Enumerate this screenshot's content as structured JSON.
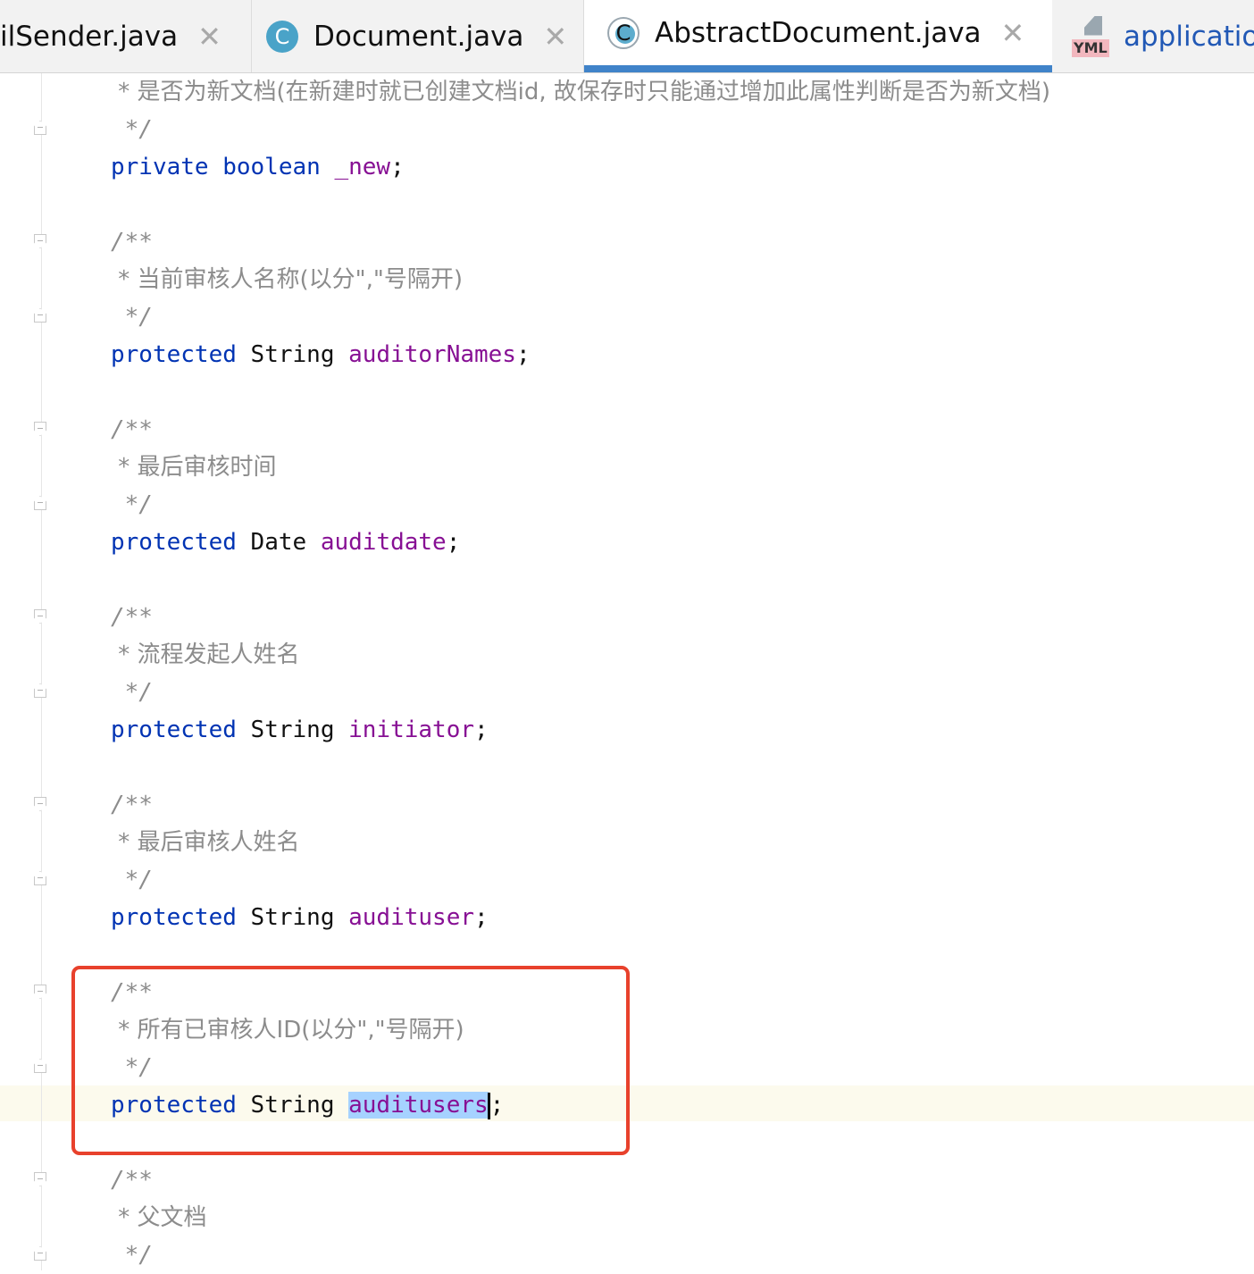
{
  "tabs": [
    {
      "label": "ilSender.java",
      "icon": "none",
      "closable": true
    },
    {
      "label": "Document.java",
      "icon": "class-icon",
      "closable": true
    },
    {
      "label": "AbstractDocument.java",
      "icon": "abstract-class-icon",
      "closable": true,
      "active": true
    },
    {
      "label": "applicatio",
      "icon": "yml-file-icon",
      "icon_text": "YML"
    }
  ],
  "colors": {
    "keyword": "#0033b3",
    "field": "#871094",
    "comment": "#8c8c8c",
    "selection": "#a6d2ff",
    "highlight_box": "#e8412c",
    "active_tab": "#4083c9"
  },
  "code": {
    "l1": " * 是否为新文档(在新建时就已创建文档id, 故保存时只能通过增加此属性判断是否为新文档)",
    "l2": " */",
    "l3_kw": "private boolean ",
    "l3_field": "_new",
    "l3_end": ";",
    "l5": "/**",
    "l6": " * 当前审核人名称(以分\",\"号隔开)",
    "l7": " */",
    "l8_kw": "protected ",
    "l8_type": "String ",
    "l8_field": "auditorNames",
    "l8_end": ";",
    "l10": "/**",
    "l11": " * 最后审核时间",
    "l12": " */",
    "l13_kw": "protected ",
    "l13_type": "Date ",
    "l13_field": "auditdate",
    "l13_end": ";",
    "l15": "/**",
    "l16": " * 流程发起人姓名",
    "l17": " */",
    "l18_kw": "protected ",
    "l18_type": "String ",
    "l18_field": "initiator",
    "l18_end": ";",
    "l20": "/**",
    "l21": " * 最后审核人姓名",
    "l22": " */",
    "l23_kw": "protected ",
    "l23_type": "String ",
    "l23_field": "audituser",
    "l23_end": ";",
    "l25": "/**",
    "l26": " * 所有已审核人ID(以分\",\"号隔开)",
    "l27": " */",
    "l28_kw": "protected ",
    "l28_type": "String ",
    "l28_field": "auditusers",
    "l28_end": ";",
    "l30": "/**",
    "l31": " * 父文档",
    "l32": " */"
  }
}
